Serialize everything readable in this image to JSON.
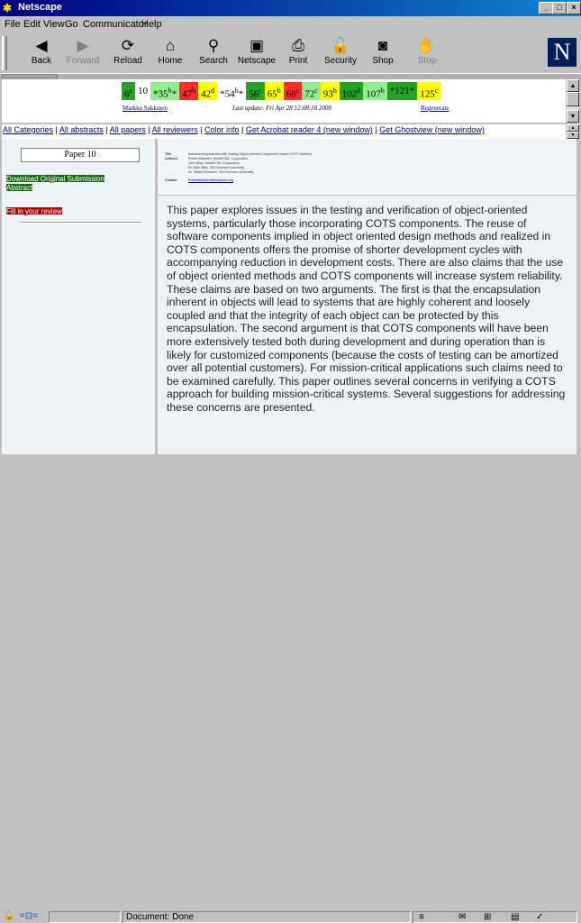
{
  "window": {
    "title": "Netscape",
    "title_icon": "netscape-wheel-icon",
    "buttons": [
      "_",
      "□",
      "×"
    ]
  },
  "menu": [
    "File",
    "Edit",
    "View",
    "Go",
    "Communicator",
    "Help"
  ],
  "toolbar": [
    {
      "label": "Back",
      "icon": "back-arrow-icon",
      "glyph": "◀",
      "enabled": true
    },
    {
      "label": "Forward",
      "icon": "forward-arrow-icon",
      "glyph": "▶",
      "enabled": false
    },
    {
      "label": "Reload",
      "icon": "reload-icon",
      "glyph": "⟳",
      "enabled": true
    },
    {
      "label": "Home",
      "icon": "home-icon",
      "glyph": "⌂",
      "enabled": true
    },
    {
      "label": "Search",
      "icon": "search-icon",
      "glyph": "⚲",
      "enabled": true
    },
    {
      "label": "Netscape",
      "icon": "netscape-icon",
      "glyph": "▣",
      "enabled": true
    },
    {
      "label": "Print",
      "icon": "print-icon",
      "glyph": "⎙",
      "enabled": true
    },
    {
      "label": "Security",
      "icon": "lock-icon",
      "glyph": "🔓",
      "enabled": true
    },
    {
      "label": "Shop",
      "icon": "shop-icon",
      "glyph": "◙",
      "enabled": true
    },
    {
      "label": "Stop",
      "icon": "stop-icon",
      "glyph": "✋",
      "enabled": false
    }
  ],
  "logo": "N",
  "scores": [
    {
      "text": "6",
      "sup": "c",
      "bg": "#22a322"
    },
    {
      "text": "10",
      "sup": "",
      "bg": "#ffffff"
    },
    {
      "text": "*35",
      "sup": "b",
      "suffix": "*",
      "bg": "#90ee90"
    },
    {
      "text": "47",
      "sup": "b",
      "bg": "#ff2a2a"
    },
    {
      "text": "42",
      "sup": "d",
      "bg": "#ffff00"
    },
    {
      "text": "*54",
      "sup": "b",
      "suffix": "*",
      "bg": "#ffffff"
    },
    {
      "text": "56",
      "sup": "c",
      "bg": "#22a322"
    },
    {
      "text": "65",
      "sup": "b",
      "bg": "#ffff00"
    },
    {
      "text": "68",
      "sup": "c",
      "bg": "#ff2a2a"
    },
    {
      "text": "72",
      "sup": "c",
      "bg": "#90ee90"
    },
    {
      "text": "93",
      "sup": "b",
      "bg": "#ffff00"
    },
    {
      "text": "102",
      "sup": "d",
      "bg": "#22a322"
    },
    {
      "text": "107",
      "sup": "b",
      "bg": "#90ee90"
    },
    {
      "text": "*121",
      "sup": "",
      "suffix": "*",
      "bg": "#22a322"
    },
    {
      "text": "125",
      "sup": "c",
      "bg": "#ffff00"
    }
  ],
  "info_row": {
    "person": "Markku Sakkinen",
    "last_update": "Last update: Fri Apr 28 12:08:10 2000",
    "regenerate": "Regenerate"
  },
  "nav_links": [
    "All Categories",
    "All abstracts",
    "All papers",
    "All reviewers",
    "Color info",
    "Get Acrobat reader 4 (new window)",
    "Get Ghostview (new window)"
  ],
  "left": {
    "paper_title": "Paper 10",
    "link1": "Download Original Submission",
    "link2": "Abstract",
    "link3": "Fill in your review"
  },
  "meta": [
    {
      "k": "Title",
      "v": "Assessed Approaches with Testing Object-oriented Component-based COTS Systems"
    },
    {
      "k": "Authors",
      "v": "Robert Marsden, WorldCOM, Corporation"
    },
    {
      "k": "",
      "v": "John Berg, WorldCOM, Corporation"
    },
    {
      "k": "",
      "v": "Dr. Alice Wills, Old Dominion University"
    },
    {
      "k": "",
      "v": "Dr. Oldwin Knudsen, Old Dominion University"
    },
    {
      "k": "Contact",
      "v": "RobertMarsden@worldcom.org"
    }
  ],
  "abstract": "This paper explores issues in the testing and verification of object-oriented systems, particularly those incorporating COTS components. The reuse of software components implied in object oriented design methods and realized in COTS components offers the promise of shorter development cycles with accompanying reduction in development costs. There are also claims that the use of object oriented methods and COTS components will increase system reliability. These claims are based on two arguments. The first is that the encapsulation inherent in objects will lead to systems that are highly coherent and loosely coupled and that the integrity of each object can be protected by this encapsulation. The second argument is that COTS components will have been more extensively tested both during development and during operation than is likely for customized components (because the costs of testing can be amortized over all potential customers). For mission-critical applications such claims need to be examined carefully. This paper outlines several concerns in verifying a COTS approach for building mission-critical systems. Several suggestions for addressing these concerns are presented.",
  "status": {
    "text": "Document: Done",
    "icons": [
      "security-icon",
      "component-bar-icon",
      "mail-icon",
      "discussion-icon",
      "composer-icon"
    ]
  }
}
